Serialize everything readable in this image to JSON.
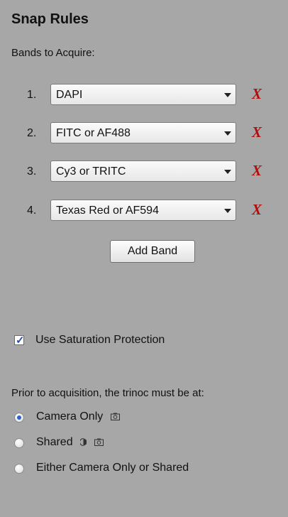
{
  "panel": {
    "title": "Snap Rules",
    "bands_label": "Bands to Acquire:",
    "bands": [
      {
        "num": "1.",
        "value": "DAPI"
      },
      {
        "num": "2.",
        "value": "FITC or AF488"
      },
      {
        "num": "3.",
        "value": "Cy3 or TRITC"
      },
      {
        "num": "4.",
        "value": "Texas Red or AF594"
      }
    ],
    "remove_glyph": "X",
    "add_band_label": "Add Band",
    "saturation_label": "Use Saturation Protection",
    "saturation_checked": true,
    "prior_label": "Prior to acquisition, the trinoc must be at:",
    "trinoc_options": [
      {
        "label": "Camera Only",
        "selected": true,
        "icons": [
          "camera-icon"
        ]
      },
      {
        "label": "Shared",
        "selected": false,
        "icons": [
          "eyepiece-icon",
          "camera-icon"
        ]
      },
      {
        "label": "Either Camera Only or Shared",
        "selected": false,
        "icons": []
      }
    ]
  },
  "colors": {
    "background": "#a7a7a7",
    "remove": "#b10d0d",
    "radio_selected": "#2a63c9"
  }
}
